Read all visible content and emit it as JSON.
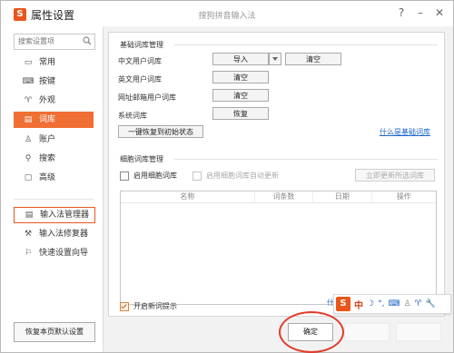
{
  "window": {
    "title": "属性设置",
    "subtitle": "搜狗拼音输入法",
    "help_glyph": "?",
    "minimize_glyph": "–",
    "close_glyph": "✕",
    "logo_text": "S"
  },
  "sidebar": {
    "search_placeholder": "搜索设置项",
    "items": [
      {
        "label": "常用",
        "icon": "monitor-icon",
        "glyph": "▭"
      },
      {
        "label": "按键",
        "icon": "keyboard-icon",
        "glyph": "⌨"
      },
      {
        "label": "外观",
        "icon": "shirt-icon",
        "glyph": "♈"
      },
      {
        "label": "词库",
        "icon": "dictionary-icon",
        "glyph": "▤",
        "active": true
      },
      {
        "label": "账户",
        "icon": "user-icon",
        "glyph": "♙"
      },
      {
        "label": "搜索",
        "icon": "search-icon",
        "glyph": "⚲"
      },
      {
        "label": "高级",
        "icon": "advanced-icon",
        "glyph": "▢"
      }
    ],
    "tools": [
      {
        "label": "输入法管理器",
        "icon": "manager-icon",
        "glyph": "▤"
      },
      {
        "label": "输入法修复器",
        "icon": "repair-icon",
        "glyph": "⚒"
      },
      {
        "label": "快速设置向导",
        "icon": "flag-icon",
        "glyph": "⚐"
      }
    ],
    "restore_label": "恢复本页默认设置"
  },
  "basic": {
    "title": "基础词库管理",
    "rows": [
      {
        "label": "中文用户词库",
        "primary": "导入",
        "secondary": "清空"
      },
      {
        "label": "英文用户词库",
        "primary": "清空"
      },
      {
        "label": "网址邮箱用户词库",
        "primary": "清空"
      },
      {
        "label": "系统词库",
        "primary": "恢复"
      }
    ],
    "reset_label": "一键恢复到初始状态",
    "help_link": "什么是基础词库"
  },
  "cell": {
    "title": "细胞词库管理",
    "enable_label": "启用细胞词库",
    "auto_update_label": "启用细胞词库自动更新",
    "update_now_label": "立即更新所选词库",
    "columns": [
      "名称",
      "词条数",
      "日期",
      "操作"
    ],
    "new_word_hint_label": "开启新词提示"
  },
  "ime_toolbar": {
    "logo_text": "S",
    "mode": "中",
    "side_text": "什",
    "icons": [
      "moon-icon",
      "punctuation-icon",
      "soft-keyboard-icon",
      "user-icon",
      "shirt-icon",
      "wrench-icon"
    ],
    "glyphs": [
      "☽",
      "°,",
      "⌨",
      "♙",
      "♈",
      "🔧"
    ]
  },
  "ok_label": "确定",
  "colors": {
    "accent": "#ef6f34",
    "link": "#1b66c9",
    "highlight_circle": "#e23b2a"
  }
}
